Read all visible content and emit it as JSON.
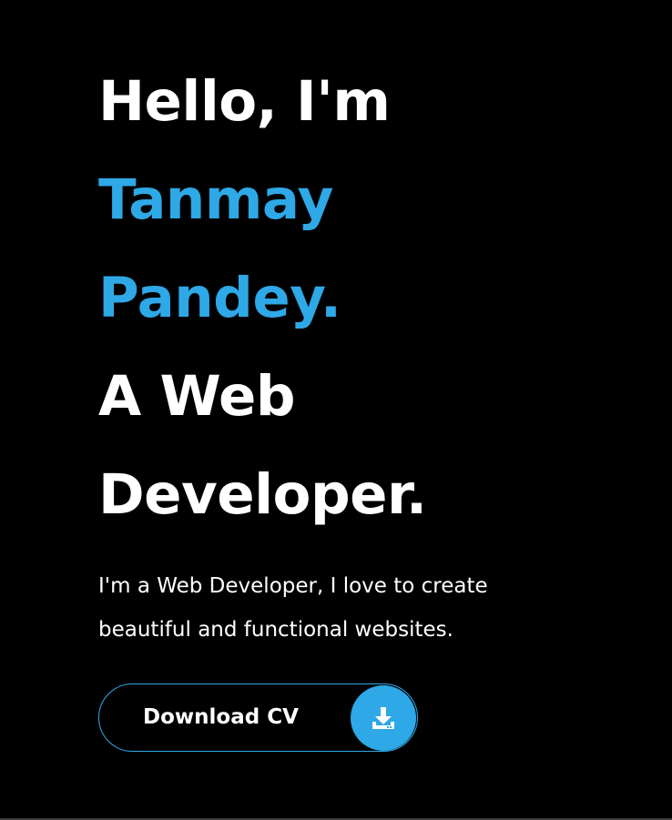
{
  "hero": {
    "greeting": "Hello, I'm",
    "name_first": "Tanmay",
    "name_last": "Pandey.",
    "role_line1": "A Web",
    "role_line2": "Developer.",
    "tagline_line1": "I'm a Web Developer, I love to create",
    "tagline_line2": "beautiful and functional websites."
  },
  "cta": {
    "label": "Download CV",
    "icon": "download-icon"
  },
  "colors": {
    "background": "#000000",
    "text": "#ffffff",
    "accent": "#2ea8e6"
  }
}
